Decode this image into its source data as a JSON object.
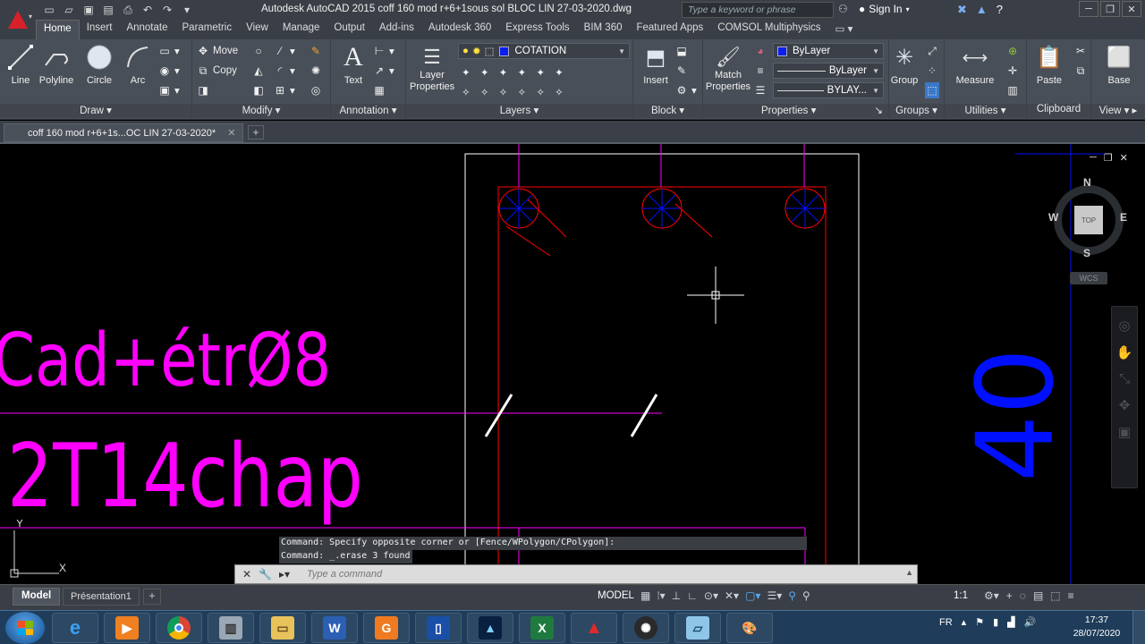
{
  "window": {
    "title": "Autodesk AutoCAD 2015    coff 160 mod r+6+1sous sol  BLOC LIN 27-03-2020.dwg",
    "search_placeholder": "Type a keyword or phrase",
    "sign_in": "Sign In"
  },
  "ribbon_tabs": [
    "Home",
    "Insert",
    "Annotate",
    "Parametric",
    "View",
    "Manage",
    "Output",
    "Add-ins",
    "Autodesk 360",
    "Express Tools",
    "BIM 360",
    "Featured Apps",
    "COMSOL Multiphysics"
  ],
  "panels": {
    "draw": {
      "title": "Draw",
      "tools": [
        "Line",
        "Polyline",
        "Circle",
        "Arc"
      ]
    },
    "modify": {
      "title": "Modify",
      "move": "Move",
      "copy": "Copy"
    },
    "annotation": {
      "title": "Annotation",
      "text": "Text"
    },
    "layers": {
      "title": "Layers",
      "layer_properties": "Layer\nProperties",
      "current_layer": "COTATION"
    },
    "block": {
      "title": "Block",
      "insert": "Insert"
    },
    "properties": {
      "title": "Properties",
      "match": "Match\nProperties",
      "color": "ByLayer",
      "linetype": "ByLayer",
      "lineweight": "BYLAY..."
    },
    "groups": {
      "title": "Groups",
      "group": "Group"
    },
    "utilities": {
      "title": "Utilities",
      "measure": "Measure"
    },
    "clipboard": {
      "title": "Clipboard",
      "paste": "Paste"
    },
    "view": {
      "title": "View",
      "base": "Base"
    }
  },
  "document_tab": "coff 160 mod r+6+1s...OC LIN 27-03-2020*",
  "drawing": {
    "text_line1": "Cad+étrØ8",
    "text_line2": "2T14chap",
    "dimension": "40",
    "colors": {
      "magenta": "#ff00ff",
      "red": "#ff0000",
      "blue": "#0010ff",
      "white": "#ffffff"
    }
  },
  "viewcube": {
    "n": "N",
    "s": "S",
    "e": "E",
    "w": "W",
    "top": "TOP",
    "wcs": "WCS"
  },
  "command": {
    "history": [
      "Command: Specify opposite corner or [Fence/WPolygon/CPolygon]:",
      "Command: _.erase 3 found"
    ],
    "placeholder": "Type a command"
  },
  "layout_tabs": {
    "model": "Model",
    "layout1": "Présentation1"
  },
  "status": {
    "model": "MODEL",
    "scale": "1:1"
  },
  "taskbar": {
    "apps": [
      "internet-explorer",
      "media-player",
      "chrome",
      "calculator",
      "file-explorer",
      "word",
      "pdf-app",
      "phone-app",
      "map-app",
      "excel",
      "autocad",
      "settings-app",
      "notes-app",
      "paint"
    ],
    "lang": "FR",
    "time": "17:37",
    "date": "28/07/2020"
  }
}
